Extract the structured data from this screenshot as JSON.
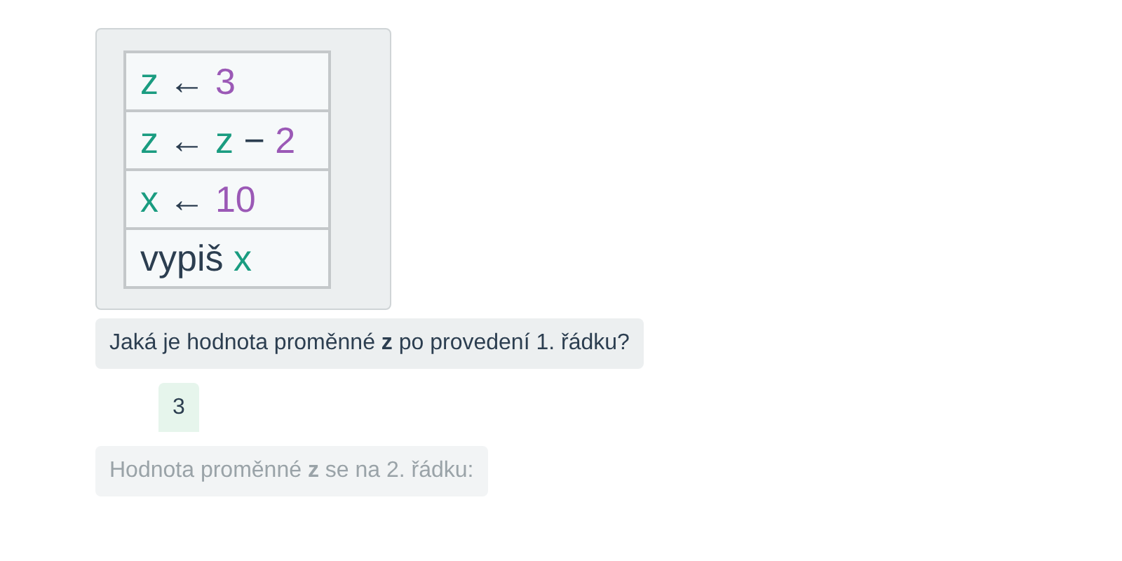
{
  "items": [
    {
      "kind": "program",
      "lines": [
        [
          {
            "text": "z",
            "kind": "var"
          },
          {
            "text": "←",
            "kind": "op"
          },
          {
            "text": "3",
            "kind": "num"
          }
        ],
        [
          {
            "text": "z",
            "kind": "var"
          },
          {
            "text": "←",
            "kind": "op"
          },
          {
            "text": "z",
            "kind": "var"
          },
          {
            "text": "−",
            "kind": "op"
          },
          {
            "text": "2",
            "kind": "num"
          }
        ],
        [
          {
            "text": "x",
            "kind": "var"
          },
          {
            "text": "←",
            "kind": "op"
          },
          {
            "text": "10",
            "kind": "num"
          }
        ],
        [
          {
            "text": "vypiš",
            "kind": "kw"
          },
          {
            "text": "x",
            "kind": "var"
          }
        ]
      ]
    },
    {
      "kind": "question",
      "text": "Jaká je hodnota proměnné **z** po provedení 1. řádku?",
      "dimmed": false
    },
    {
      "kind": "answer",
      "text": "3"
    },
    {
      "kind": "question",
      "text": "Hodnota proměnné **z** se na 2. řádku:",
      "dimmed": true
    }
  ]
}
